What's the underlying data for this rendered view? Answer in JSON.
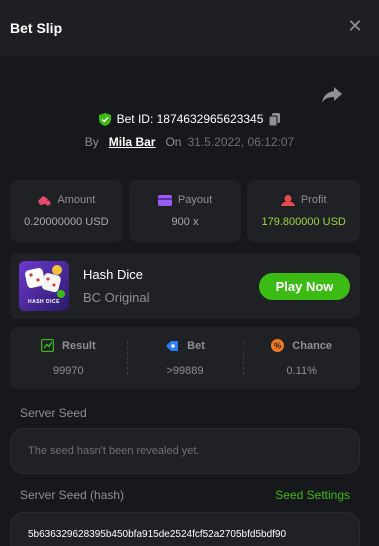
{
  "header": {
    "title": "Bet Slip"
  },
  "bet": {
    "id_text": "Bet ID: 1874632965623345",
    "by_label": "By",
    "user": "Mila Bar",
    "on_label": "On",
    "date": "31.5.2022, 06:12:07"
  },
  "stats": [
    {
      "label": "Amount",
      "value": "0.20000000 USD",
      "icon": "amount-icon"
    },
    {
      "label": "Payout",
      "value": "900 x",
      "icon": "payout-icon"
    },
    {
      "label": "Profit",
      "value": "179.800000 USD",
      "icon": "profit-icon"
    }
  ],
  "game": {
    "thumb_text": "HASH DICE",
    "name": "Hash Dice",
    "provider": "BC Original",
    "play_label": "Play Now"
  },
  "result": [
    {
      "label": "Result",
      "value": "99970",
      "icon": "result-icon"
    },
    {
      "label": "Bet",
      "value": ">99889",
      "icon": "bet-icon"
    },
    {
      "label": "Chance",
      "value": "0.11%",
      "icon": "chance-icon"
    }
  ],
  "server_seed": {
    "label": "Server Seed",
    "value": "The seed hasn't been revealed yet."
  },
  "server_seed_hash": {
    "label": "Server Seed (hash)",
    "settings_label": "Seed Settings",
    "value": "5b636329628395b450bfa915de2524fcf52a2705bfd5bdf90"
  },
  "colors": {
    "accent_green": "#3cbb15",
    "profit_green": "#9dd83f",
    "background": "#17181b",
    "panel": "#202125"
  }
}
